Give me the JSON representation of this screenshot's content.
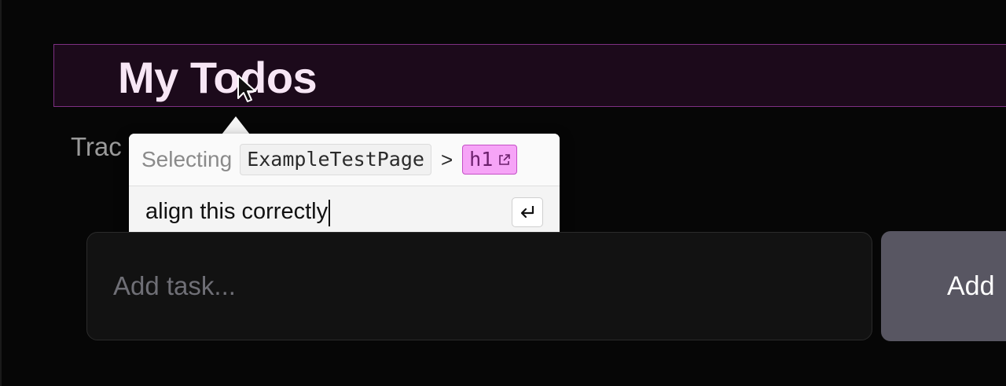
{
  "app": {
    "title": "My Todos",
    "subtitle": "Trac"
  },
  "inspector": {
    "selecting_label": "Selecting",
    "component_name": "ExampleTestPage",
    "separator": ">",
    "element_tag": "h1",
    "instruction_text": "align this correctly",
    "submit_icon": "return-icon",
    "external_link_icon": "external-link-icon"
  },
  "task_form": {
    "input_placeholder": "Add task...",
    "add_label": "Add"
  },
  "colors": {
    "background": "#060606",
    "highlight_border": "#7d2f82",
    "element_chip": "#f6a4f7",
    "add_button": "#585662"
  }
}
